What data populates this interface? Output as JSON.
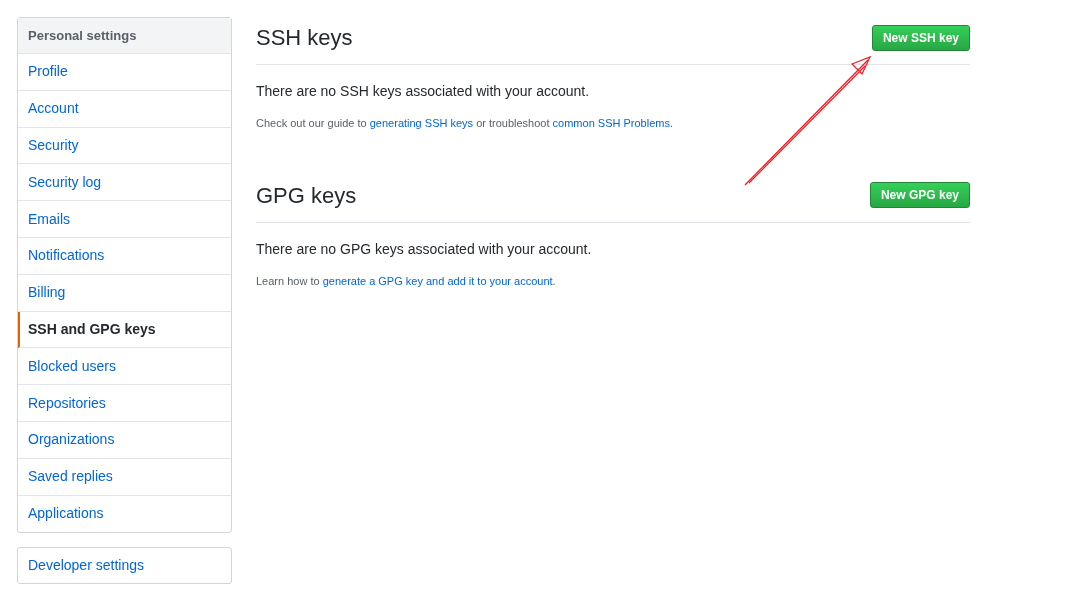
{
  "sidebar": {
    "heading": "Personal settings",
    "items": [
      {
        "label": "Profile",
        "selected": false
      },
      {
        "label": "Account",
        "selected": false
      },
      {
        "label": "Security",
        "selected": false
      },
      {
        "label": "Security log",
        "selected": false
      },
      {
        "label": "Emails",
        "selected": false
      },
      {
        "label": "Notifications",
        "selected": false
      },
      {
        "label": "Billing",
        "selected": false
      },
      {
        "label": "SSH and GPG keys",
        "selected": true
      },
      {
        "label": "Blocked users",
        "selected": false
      },
      {
        "label": "Repositories",
        "selected": false
      },
      {
        "label": "Organizations",
        "selected": false
      },
      {
        "label": "Saved replies",
        "selected": false
      },
      {
        "label": "Applications",
        "selected": false
      }
    ]
  },
  "developer_settings": "Developer settings",
  "sections": [
    {
      "title": "SSH keys",
      "button": "New SSH key",
      "message": "There are no SSH keys associated with your account.",
      "hint": [
        {
          "kind": "text",
          "text": "Check out our guide to "
        },
        {
          "kind": "link",
          "text": "generating SSH keys"
        },
        {
          "kind": "text",
          "text": " or troubleshoot "
        },
        {
          "kind": "link",
          "text": "common SSH Problems"
        },
        {
          "kind": "text",
          "text": "."
        }
      ]
    },
    {
      "title": "GPG keys",
      "button": "New GPG key",
      "message": "There are no GPG keys associated with your account.",
      "hint": [
        {
          "kind": "text",
          "text": "Learn how to "
        },
        {
          "kind": "link",
          "text": "generate a GPG key and add it to your account"
        },
        {
          "kind": "text",
          "text": "."
        }
      ]
    }
  ]
}
